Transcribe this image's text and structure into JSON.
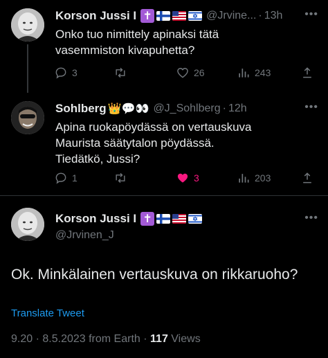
{
  "tweets": [
    {
      "name": "Korson Jussi I",
      "handle": "@Jrvine...",
      "time": "13h",
      "text": "Onko tuo nimittely apinaksi tätä\nvasemmiston kivapuhetta?",
      "replies": "3",
      "retweets": "",
      "likes": "26",
      "views": "243"
    },
    {
      "name": "Sohlberg",
      "name_emojis": "👑💬👀",
      "handle": "@J_Sohlberg",
      "time": "12h",
      "text": "Apina ruokapöydässä on vertauskuva\nMaurista säätytalon pöydässä.\nTiedätkö, Jussi?",
      "replies": "1",
      "retweets": "",
      "likes": "3",
      "views": "203"
    }
  ],
  "main": {
    "name": "Korson Jussi I",
    "handle": "@Jrvinen_J",
    "text": "Ok. Minkälainen vertauskuva on rikkaruoho?",
    "translate_label": "Translate Tweet",
    "time": "9.20",
    "date": "8.5.2023",
    "source": "from Earth",
    "views_count": "117",
    "views_label": "Views"
  },
  "badges": {
    "cross_symbol": "✝",
    "cross_color": "#a35ad6",
    "flags": [
      "finland-flag",
      "usa-flag",
      "israel-flag"
    ]
  },
  "colors": {
    "background": "#000000",
    "text": "#e7e9ea",
    "secondary": "#71767b",
    "link": "#1d9bf0",
    "like": "#f91880"
  }
}
